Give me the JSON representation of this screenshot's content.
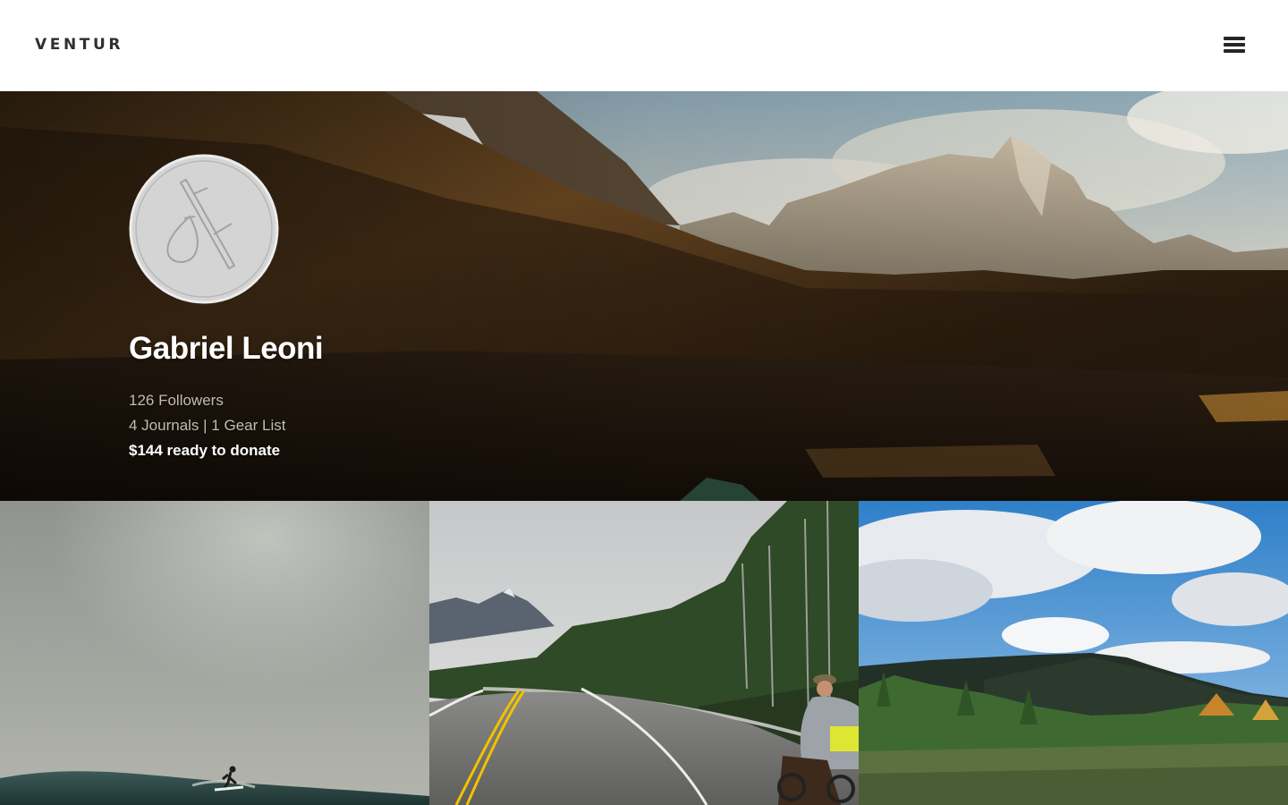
{
  "header": {
    "logo": "VENTUR",
    "menu_icon": "hamburger-menu-icon"
  },
  "profile": {
    "avatar_icon": "bindle-stick-icon",
    "name": "Gabriel Leoni",
    "followers": "126 Followers",
    "journals_gear": "4 Journals | 1 Gear List",
    "donation": "$144 ready to donate"
  },
  "hero_image": "patagonia-mountain-landscape",
  "tiles": [
    {
      "image": "surfer-on-wave"
    },
    {
      "image": "cyclist-on-mountain-road"
    },
    {
      "image": "forested-hills-under-cloudy-sky"
    }
  ],
  "colors": {
    "header_bg": "#ffffff",
    "logo": "#2f2f2f",
    "stat_text": "#c2bcb4",
    "name_text": "#ffffff",
    "road_line": "#f2c200"
  }
}
